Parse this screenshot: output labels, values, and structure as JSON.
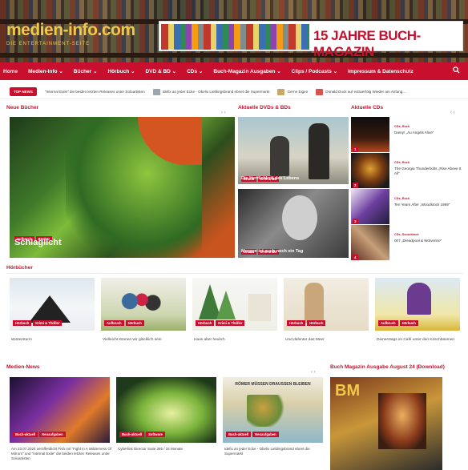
{
  "header": {
    "logo": "medien-info.com",
    "tagline": "DIE ENTERTAINMENT-SEITE",
    "banner_text": "15 JAHRE BUCH-MAGAZIN"
  },
  "nav": {
    "items": [
      "Home",
      "Medien-Info ⌄",
      "Bücher ⌄",
      "Hörbuch ⌄",
      "DVD & BD ⌄",
      "CDs ⌄",
      "Buch-Magazin Ausgaben ⌄",
      "Clips / Podcasts ⌄",
      "Impressum & Datenschutz"
    ]
  },
  "ticker": {
    "badge": "TOP NEWS",
    "items": [
      "\"Internal Exile\" die beiden letzten Releases unter Soloartisten",
      "Idefix an jeder Ecke - Obelix Lieblingsbrand ebnet die Supermarkt",
      "Gerne Eigen",
      "Donald Duck auf extraerfolg Wieder am Anfang..."
    ]
  },
  "sections": {
    "neue_buecher": "Neue Bücher",
    "aktuelle_dvds": "Aktuelle DVDs & BDs",
    "aktuelle_cds": "Aktuelle CDs",
    "hoerbuecher": "Hörbücher",
    "medien_news": "Medien-News",
    "buch_magazin": "Buch Magazin Ausgabe August 24 (Download)",
    "arrows": "‹ ›"
  },
  "hero": {
    "tags": [
      "Aufbruch",
      "Bücher"
    ],
    "title": "Schlaglicht"
  },
  "dvds": [
    {
      "tags": [
        "Drama",
        "DVD & BD"
      ],
      "title": "Die Herrlichkeit des Lebens"
    },
    {
      "tags": [
        "Drama",
        "DVD & BD"
      ],
      "title": "Morgen ist auch noch ein Tag"
    }
  ],
  "cds": [
    {
      "num": "1",
      "cat": "CDs, Rock",
      "title": "Damy! „Au Angels Alive“"
    },
    {
      "num": "2",
      "cat": "CDs, Rock",
      "title": "The Georgia Thunderbolts „Rise Above It All“"
    },
    {
      "num": "3",
      "cat": "CDs, Rock",
      "title": "Ten Years After „Woodstock 1969“"
    },
    {
      "num": "4",
      "cat": "CDs, Soundtrack",
      "title": "007 „Dreadpool & Wolverine“"
    }
  ],
  "hoerbuecher": [
    {
      "tags": [
        "Hörbuch",
        "Krimi & Thriller"
      ],
      "title": "Wintersturm"
    },
    {
      "tags": [
        "Aufbruch",
        "Hörbuch"
      ],
      "title": "Vielleicht können wir glücklich sein"
    },
    {
      "tags": [
        "Hörbuch",
        "Krimi & Thriller"
      ],
      "title": "Haus aber heulich"
    },
    {
      "tags": [
        "Hörbuch",
        "Hörbuch"
      ],
      "title": "Und dahinter das Meer"
    },
    {
      "tags": [
        "Aufbruch",
        "Hörbuch"
      ],
      "title": "Dienerstags im Café unter den Kirschbäumen"
    }
  ],
  "news": [
    {
      "tags": [
        "Buch-aktuell",
        "Neuaufgaben"
      ],
      "text": "Am 23.07.2024 veröffentlicht Fish mit \"Fight in A Wilderness Of Mirrors\" und \"Internal Exile\" die beiden letzten Releases unter Soloartisten"
    },
    {
      "tags": [
        "Buch-aktuell",
        "Software"
      ],
      "text": "Cyberlink Director Suite 365 / 34 Monate"
    },
    {
      "tags": [
        "Buch-aktuell",
        "Neuaufgaben"
      ],
      "text": "Idefix an jeder Ecke - Obelix Lieblingsbrand ebnet die Supermarkt"
    }
  ],
  "news_banner_text": "RÖMER MÜSSEN DRAUSSEN BLEIBEN",
  "magazine_logo": "BM",
  "colors": {
    "accent": "#c8102e",
    "logo": "#f2c84b"
  }
}
